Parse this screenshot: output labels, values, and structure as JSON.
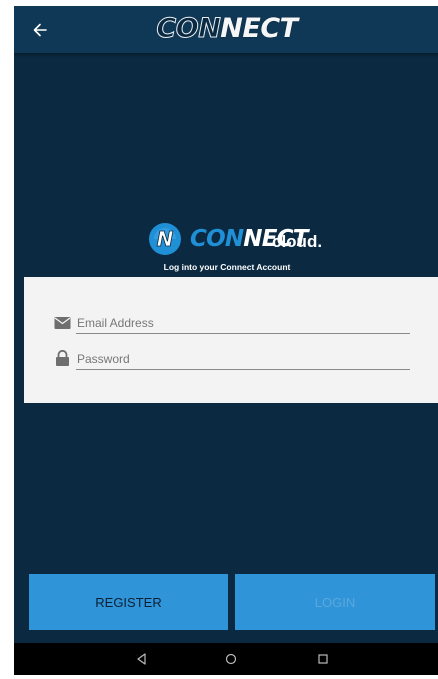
{
  "app_bar": {
    "title_part1": "CON",
    "title_part2": "NECT",
    "back_icon": "arrow-left-icon"
  },
  "logo": {
    "mark_letter": "N",
    "word_part1": "CON",
    "word_part2": "NECT",
    "suffix": "cloud."
  },
  "login": {
    "subtitle": "Log into your Connect Account",
    "email_placeholder": "Email Address",
    "email_icon": "envelope-icon",
    "password_placeholder": "Password",
    "password_icon": "lock-icon"
  },
  "actions": {
    "register_label": "REGISTER",
    "login_label": "LOGIN"
  },
  "colors": {
    "background": "#0b2a42",
    "app_bar": "#0f3856",
    "button": "#2f95d8",
    "card": "#f3f3f3"
  }
}
